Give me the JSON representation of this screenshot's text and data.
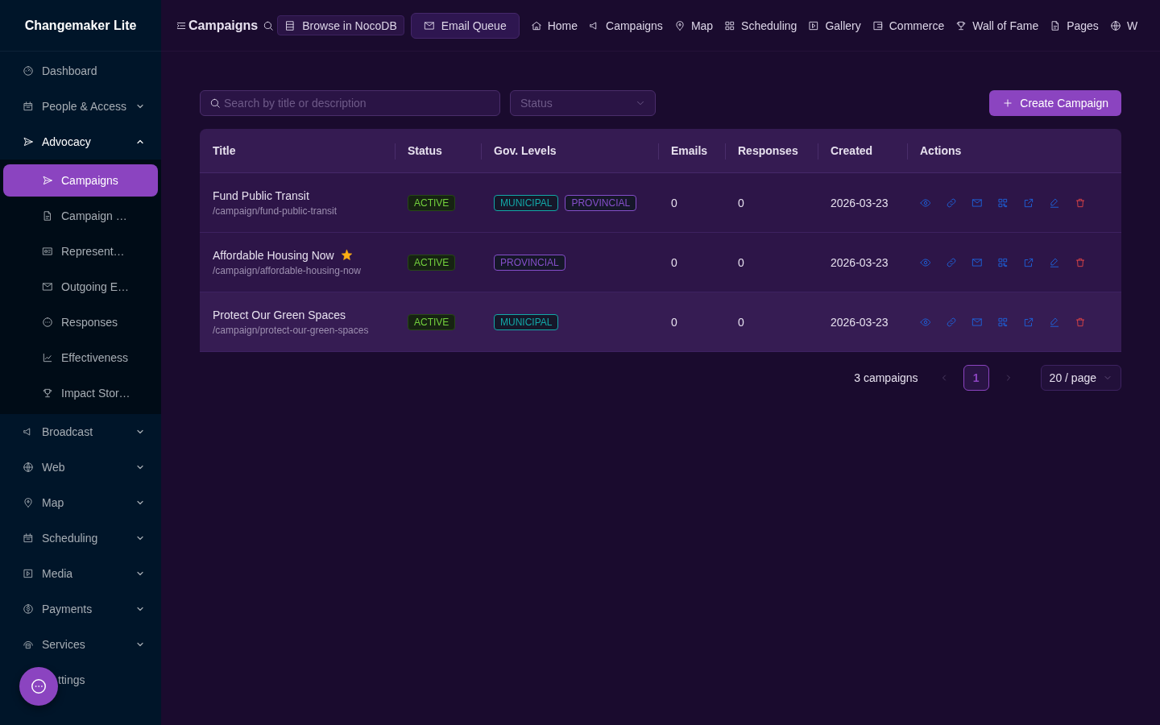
{
  "brand": "Changemaker Lite",
  "header": {
    "page_title": "Campaigns",
    "buttons": [
      {
        "label": "Browse in NocoDB",
        "selected": false
      },
      {
        "label": "Email Queue",
        "selected": true
      }
    ],
    "nav": [
      "Home",
      "Campaigns",
      "Map",
      "Scheduling",
      "Gallery",
      "Commerce",
      "Wall of Fame",
      "Pages",
      "W"
    ]
  },
  "sidebar": {
    "items": [
      {
        "label": "Dashboard",
        "selected": false
      },
      {
        "label": "People & Access",
        "selected": false,
        "expanded": false
      },
      {
        "label": "Advocacy",
        "selected": false,
        "expanded": true,
        "children": [
          {
            "label": "Campaigns",
            "selected": true
          },
          {
            "label": "Campaign …",
            "selected": false
          },
          {
            "label": "Represent…",
            "selected": false
          },
          {
            "label": "Outgoing E…",
            "selected": false
          },
          {
            "label": "Responses",
            "selected": false
          },
          {
            "label": "Effectiveness",
            "selected": false
          },
          {
            "label": "Impact Stor…",
            "selected": false
          }
        ]
      },
      {
        "label": "Broadcast",
        "selected": false,
        "expanded": false
      },
      {
        "label": "Web",
        "selected": false,
        "expanded": false
      },
      {
        "label": "Map",
        "selected": false,
        "expanded": false
      },
      {
        "label": "Scheduling",
        "selected": false,
        "expanded": false
      },
      {
        "label": "Media",
        "selected": false,
        "expanded": false
      },
      {
        "label": "Payments",
        "selected": false,
        "expanded": false
      },
      {
        "label": "Services",
        "selected": false,
        "expanded": false
      },
      {
        "label": "ttings",
        "selected": false
      }
    ]
  },
  "filters": {
    "search": {
      "placeholder": "Search by title or description"
    },
    "status": {
      "placeholder": "Status"
    }
  },
  "create_button": "Create Campaign",
  "table": {
    "columns": [
      "Title",
      "Status",
      "Gov. Levels",
      "Emails",
      "Responses",
      "Created",
      "Actions"
    ],
    "rows": [
      {
        "title": "Fund Public Transit",
        "slug": "/campaign/fund-public-transit",
        "starred": false,
        "highlighted": false,
        "status": "ACTIVE",
        "levels": [
          {
            "label": "MUNICIPAL",
            "color": "#13a8a8"
          },
          {
            "label": "PROVINCIAL",
            "color": "#854eca"
          }
        ],
        "emails": "0",
        "responses": "0",
        "created": "2026-03-23"
      },
      {
        "title": "Affordable Housing Now",
        "slug": "/campaign/affordable-housing-now",
        "starred": true,
        "highlighted": false,
        "status": "ACTIVE",
        "levels": [
          {
            "label": "PROVINCIAL",
            "color": "#854eca"
          }
        ],
        "emails": "0",
        "responses": "0",
        "created": "2026-03-23"
      },
      {
        "title": "Protect Our Green Spaces",
        "slug": "/campaign/protect-our-green-spaces",
        "starred": false,
        "highlighted": true,
        "status": "ACTIVE",
        "levels": [
          {
            "label": "MUNICIPAL",
            "color": "#13a8a8"
          }
        ],
        "emails": "0",
        "responses": "0",
        "created": "2026-03-23"
      }
    ]
  },
  "pagination": {
    "total": "3 campaigns",
    "prev_disabled": true,
    "next_disabled": true,
    "pages": [
      {
        "label": "1",
        "selected": true
      }
    ],
    "page_size": "20 / page"
  }
}
